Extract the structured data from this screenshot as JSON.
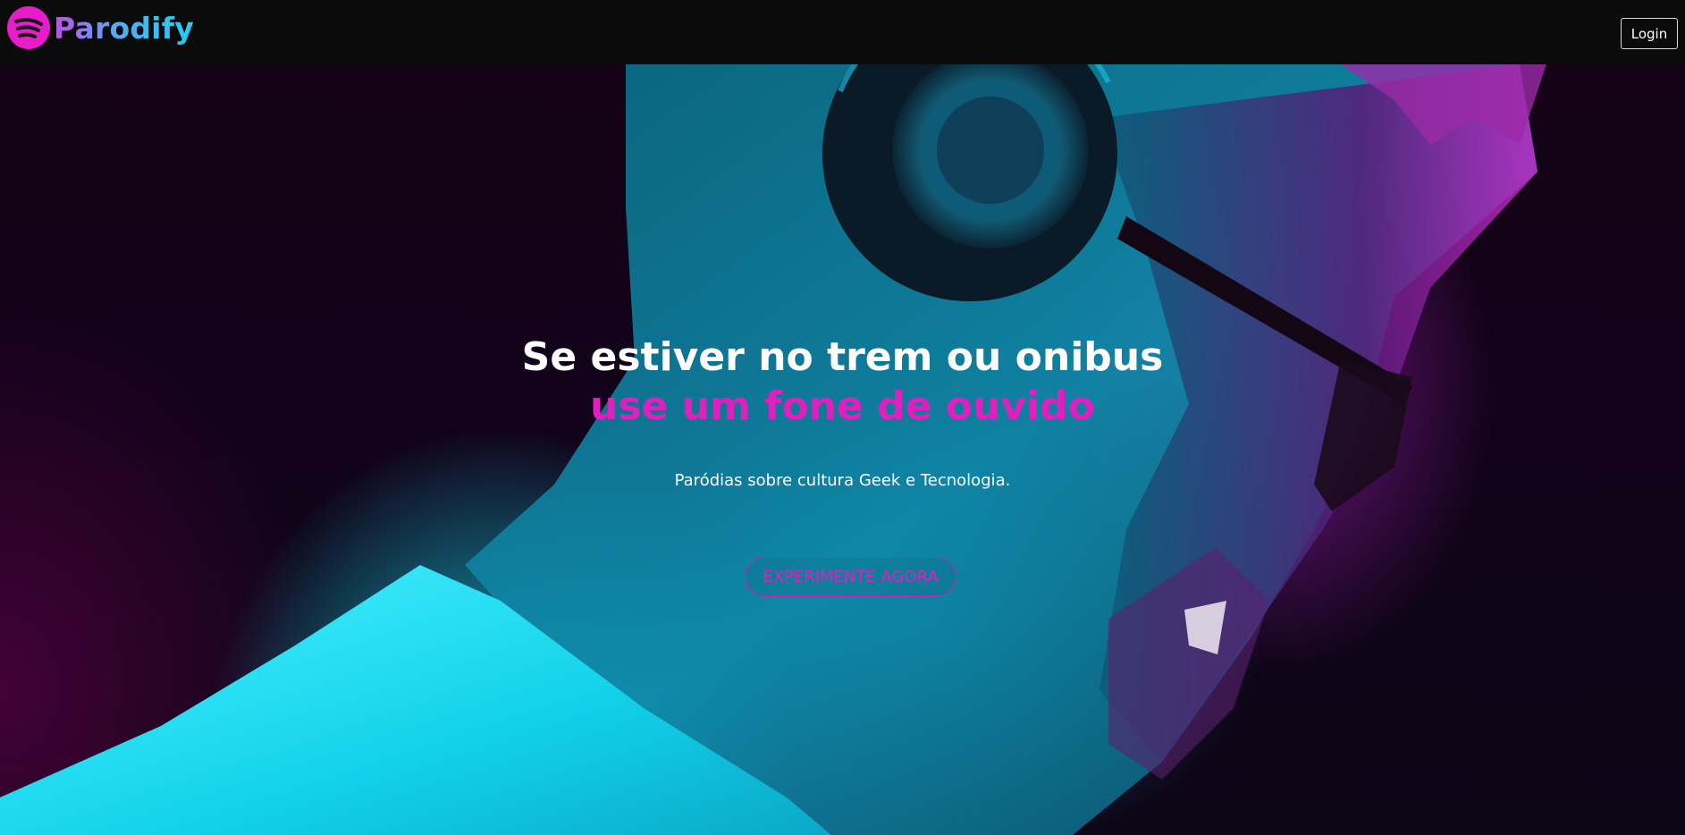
{
  "app": {
    "brand_name": "Parodify",
    "brand_icon": "sound-waves-icon",
    "brand_color": "#e81cc8"
  },
  "nav": {
    "login_label": "Login"
  },
  "hero": {
    "headline_line1": "Se estiver no trem ou onibus",
    "headline_line2": "use um fone de ouvido",
    "subtitle": "Paródias sobre cultura Geek e Tecnologia.",
    "cta_label": "EXPERIMENTE AGORA",
    "accent_color": "#e01fbf",
    "image": "man-with-headphones-neon-photo"
  }
}
